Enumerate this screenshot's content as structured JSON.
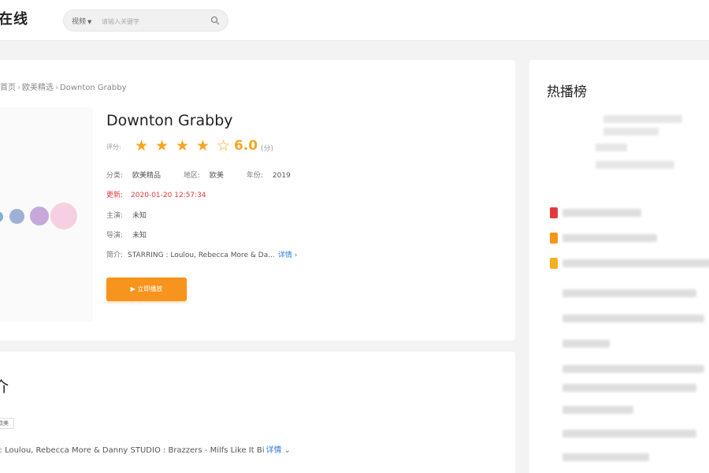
{
  "header": {
    "logo": "在线",
    "search_scope": "视频",
    "search_placeholder": "请输入关键字"
  },
  "breadcrumb": [
    "首页",
    "欧美精选",
    "Downton Grabby"
  ],
  "movie": {
    "title": "Downton Grabby",
    "rating_label": "评分:",
    "rating_stars": 4.5,
    "rating_max": 5,
    "score": "6.0",
    "score_unit": "(分)",
    "category_label": "分类:",
    "category": "欧美精品",
    "region_label": "地区:",
    "region": "欧美",
    "year_label": "年份:",
    "year": "2019",
    "updated_label": "更新:",
    "updated": "2020-01-20 12:57:34",
    "actor_label": "主演:",
    "actor": "未知",
    "director_label": "导演:",
    "director": "未知",
    "summary_label": "简介:",
    "summary": "STARRING : Loulou, Rebecca More & Da...",
    "detail_link": "详情 ›",
    "play_button": "▶ 立即播放"
  },
  "intro": {
    "title": "介",
    "tag": "欧美",
    "text": "S : Loulou, Rebecca More & Danny STUDIO : Brazzers - Milfs Like It Bi",
    "detail_link": "详情 ⌄"
  },
  "sidebar": {
    "title": "热播榜",
    "rank_colors": [
      "#e4393c",
      "#f7941d",
      "#f5b01d"
    ]
  },
  "colors": {
    "accent": "#f7941d",
    "star": "#f5a623",
    "link": "#2c7ae0",
    "date_red": "#e4393c"
  }
}
